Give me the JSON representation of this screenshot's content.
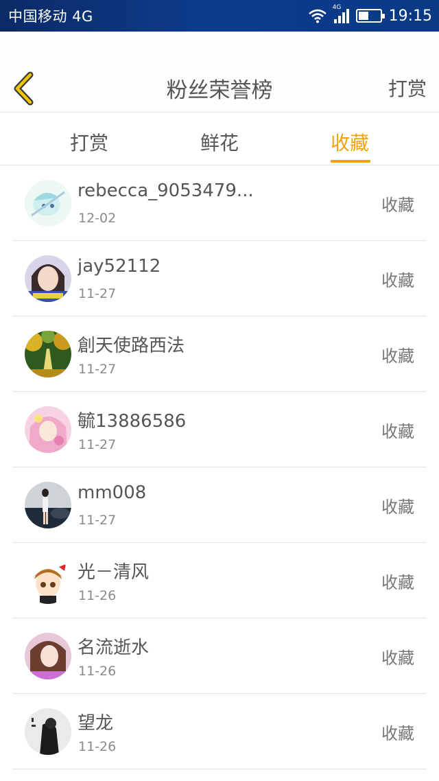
{
  "status_bar": {
    "carrier": "中国移动 4G",
    "network_badge": "4G",
    "time": "19:15",
    "battery_level": 0.45
  },
  "header": {
    "title": "粉丝荣誉榜",
    "action": "打赏"
  },
  "tabs": [
    {
      "label": "打赏",
      "active": false
    },
    {
      "label": "鲜花",
      "active": false
    },
    {
      "label": "收藏",
      "active": true
    }
  ],
  "colors": {
    "accent": "#f0a30a",
    "status_bar": "#0d3b8a",
    "text": "#555555"
  },
  "fans": [
    {
      "name": "rebecca_9053479...",
      "date": "12-02",
      "action": "收藏",
      "avatar": "avatar-anime-girl"
    },
    {
      "name": "jay52112",
      "date": "11-27",
      "action": "收藏",
      "avatar": "avatar-girl-photo"
    },
    {
      "name": "創天使路西法",
      "date": "11-27",
      "action": "收藏",
      "avatar": "avatar-forest-road"
    },
    {
      "name": "毓13886586",
      "date": "11-27",
      "action": "收藏",
      "avatar": "avatar-pink-anime"
    },
    {
      "name": "mm008",
      "date": "11-27",
      "action": "收藏",
      "avatar": "avatar-car-woman"
    },
    {
      "name": "光－清风",
      "date": "11-26",
      "action": "收藏",
      "avatar": "avatar-cartoon-boy"
    },
    {
      "name": "名流逝水",
      "date": "11-26",
      "action": "收藏",
      "avatar": "avatar-girl-pink"
    },
    {
      "name": "望龙",
      "date": "11-26",
      "action": "收藏",
      "avatar": "avatar-dark-figure"
    }
  ]
}
